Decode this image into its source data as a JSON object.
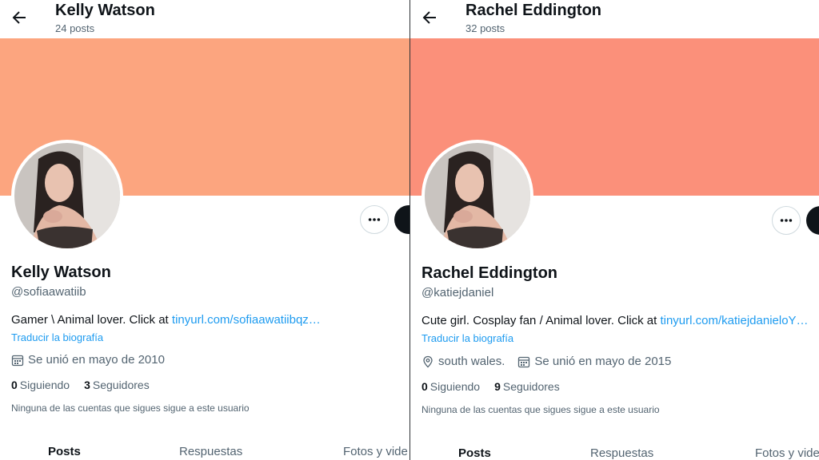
{
  "colors": {
    "banner_left": "#fca57f",
    "banner_right": "#fb907a",
    "link": "#1d9bf0",
    "muted": "#536471"
  },
  "left": {
    "header": {
      "name": "Kelly Watson",
      "posts": "24 posts"
    },
    "profile": {
      "name": "Kelly Watson",
      "handle": "@sofiaawatiib",
      "bio_text": "Gamer \\ Animal lover. Click at ",
      "bio_link": "tinyurl.com/sofiaawatiibqz…",
      "translate": "Traducir la biografía",
      "joined": "Se unió en mayo de 2010",
      "following_count": "0",
      "following_label": "Siguiendo",
      "followers_count": "3",
      "followers_label": "Seguidores",
      "no_followers_note": "Ninguna de las cuentas que sigues sigue a este usuario"
    },
    "tabs": [
      "Posts",
      "Respuestas",
      "Fotos y vide"
    ]
  },
  "right": {
    "header": {
      "name": "Rachel Eddington",
      "posts": "32 posts"
    },
    "profile": {
      "name": "Rachel Eddington",
      "handle": "@katiejdaniel",
      "bio_text": "Cute girl. Cosplay fan / Animal lover. Click at ",
      "bio_link": "tinyurl.com/katiejdanieloY…",
      "translate": "Traducir la biografía",
      "location": "south wales.",
      "joined": "Se unió en mayo de 2015",
      "following_count": "0",
      "following_label": "Siguiendo",
      "followers_count": "9",
      "followers_label": "Seguidores",
      "no_followers_note": "Ninguna de las cuentas que sigues sigue a este usuario"
    },
    "tabs": [
      "Posts",
      "Respuestas",
      "Fotos y vide"
    ]
  },
  "icons": [
    "back-arrow-icon",
    "more-dots-icon",
    "calendar-icon",
    "location-pin-icon"
  ]
}
